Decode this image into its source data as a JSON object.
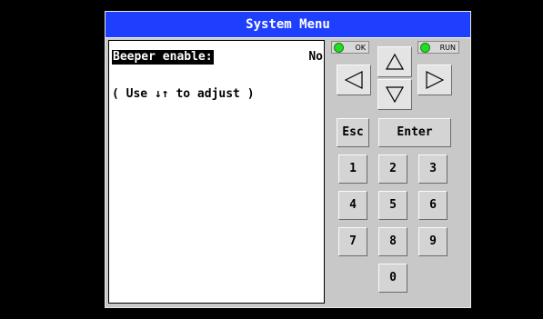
{
  "window": {
    "title": "System Menu"
  },
  "screen": {
    "setting_label": "Beeper enable:",
    "setting_value": "No",
    "hint": "( Use ↓↑ to adjust )"
  },
  "indicators": {
    "ok_label": "OK",
    "run_label": "RUN",
    "ok_color": "#22dd22",
    "run_color": "#22dd22"
  },
  "keypad": {
    "up_icon": "up-arrow",
    "down_icon": "down-arrow",
    "left_icon": "left-arrow",
    "right_icon": "right-arrow",
    "esc": "Esc",
    "enter": "Enter",
    "digits": [
      "1",
      "2",
      "3",
      "4",
      "5",
      "6",
      "7",
      "8",
      "9",
      "0"
    ]
  },
  "colors": {
    "titlebar": "#1f3fff",
    "panel": "#c8c8c8",
    "background": "#000000"
  }
}
